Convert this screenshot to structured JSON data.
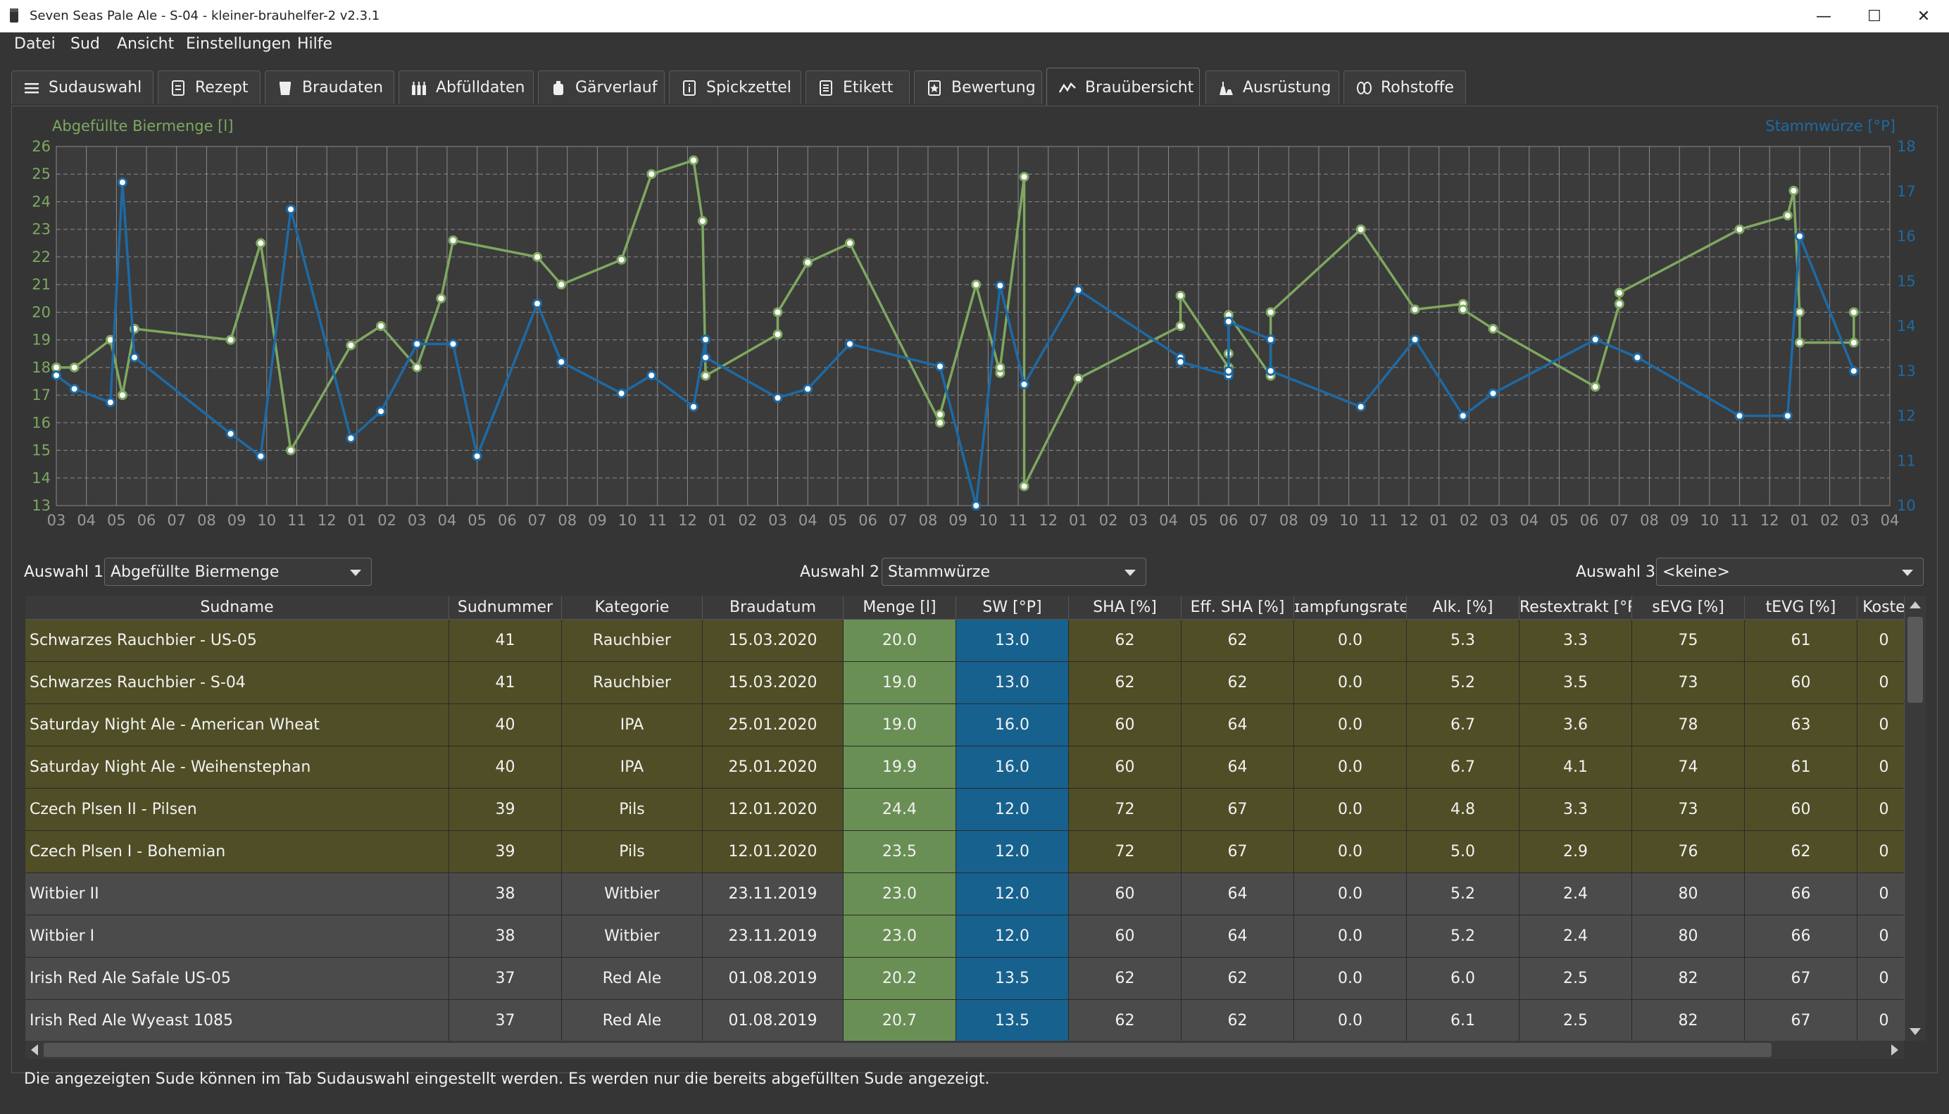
{
  "window": {
    "title": "Seven Seas Pale Ale - S-04 - kleiner-brauhelfer-2 v2.3.1",
    "minimize": "—",
    "maximize": "☐",
    "close": "✕"
  },
  "menu": [
    "Datei",
    "Sud",
    "Ansicht",
    "Einstellungen",
    "Hilfe"
  ],
  "tabs": [
    {
      "label": "Sudauswahl",
      "icon": "list-icon"
    },
    {
      "label": "Rezept",
      "icon": "recipe-icon"
    },
    {
      "label": "Braudaten",
      "icon": "kettle-icon"
    },
    {
      "label": "Abfülldaten",
      "icon": "bottles-icon"
    },
    {
      "label": "Gärverlauf",
      "icon": "fermenter-icon"
    },
    {
      "label": "Spickzettel",
      "icon": "info-note-icon"
    },
    {
      "label": "Etikett",
      "icon": "label-icon"
    },
    {
      "label": "Bewertung",
      "icon": "star-icon"
    },
    {
      "label": "Brauübersicht",
      "icon": "chart-icon",
      "active": true
    },
    {
      "label": "Ausrüstung",
      "icon": "equipment-icon"
    },
    {
      "label": "Rohstoffe",
      "icon": "hops-icon"
    }
  ],
  "chart_data": {
    "type": "line",
    "title": "",
    "ylabel_left": "Abgefüllte Biermenge [l]",
    "ylabel_right": "Stammwürze [°P]",
    "ylim_left": [
      13,
      26
    ],
    "ylim_right": [
      10,
      18
    ],
    "yticks_left": [
      "13",
      "14",
      "15",
      "16",
      "17",
      "18",
      "19",
      "20",
      "21",
      "22",
      "23",
      "24",
      "25",
      "26"
    ],
    "yticks_right": [
      "10",
      "11",
      "12",
      "13",
      "14",
      "15",
      "16",
      "17",
      "18"
    ],
    "xticks": [
      "03",
      "04",
      "05",
      "06",
      "07",
      "08",
      "09",
      "10",
      "11",
      "12",
      "01",
      "02",
      "03",
      "04",
      "05",
      "06",
      "07",
      "08",
      "09",
      "10",
      "11",
      "12",
      "01",
      "02",
      "03",
      "04",
      "05",
      "06",
      "07",
      "08",
      "09",
      "10",
      "11",
      "12",
      "01",
      "02",
      "03",
      "04",
      "05",
      "06",
      "07",
      "08",
      "09",
      "10",
      "11",
      "12",
      "01",
      "02",
      "03",
      "04",
      "05",
      "06",
      "07",
      "08",
      "09",
      "10",
      "11",
      "12",
      "01",
      "02",
      "03",
      "04"
    ],
    "grid": true,
    "series": [
      {
        "name": "Abgefüllte Biermenge",
        "axis": "left",
        "color": "#7ea860",
        "points": [
          [
            0.0,
            18.0
          ],
          [
            0.6,
            18.0
          ],
          [
            1.8,
            19.0
          ],
          [
            2.2,
            17.0
          ],
          [
            2.6,
            19.4
          ],
          [
            5.8,
            19.0
          ],
          [
            6.8,
            22.5
          ],
          [
            7.8,
            15.0
          ],
          [
            9.8,
            18.8
          ],
          [
            10.8,
            19.5
          ],
          [
            12.0,
            18.0
          ],
          [
            12.8,
            20.5
          ],
          [
            13.2,
            22.6
          ],
          [
            16.0,
            22.0
          ],
          [
            16.8,
            21.0
          ],
          [
            18.8,
            21.9
          ],
          [
            19.8,
            25.0
          ],
          [
            21.2,
            25.5
          ],
          [
            21.5,
            23.3
          ],
          [
            21.6,
            17.7
          ],
          [
            24.0,
            19.2
          ],
          [
            24.0,
            20.0
          ],
          [
            25.0,
            21.8
          ],
          [
            26.4,
            22.5
          ],
          [
            29.4,
            16.0
          ],
          [
            29.4,
            16.3
          ],
          [
            30.6,
            21.0
          ],
          [
            31.4,
            17.8
          ],
          [
            31.4,
            18.0
          ],
          [
            32.2,
            24.9
          ],
          [
            32.2,
            13.7
          ],
          [
            34.0,
            17.6
          ],
          [
            37.4,
            19.5
          ],
          [
            37.4,
            20.6
          ],
          [
            39.0,
            18.0
          ],
          [
            39.0,
            18.5
          ],
          [
            39.0,
            19.9
          ],
          [
            40.4,
            17.7
          ],
          [
            40.4,
            20.0
          ],
          [
            43.4,
            23.0
          ],
          [
            45.2,
            20.1
          ],
          [
            46.8,
            20.3
          ],
          [
            46.8,
            20.1
          ],
          [
            47.8,
            19.4
          ],
          [
            51.2,
            17.3
          ],
          [
            52.0,
            20.3
          ],
          [
            52.0,
            20.7
          ],
          [
            56.0,
            23.0
          ],
          [
            57.6,
            23.5
          ],
          [
            57.8,
            24.4
          ],
          [
            58.0,
            20.0
          ],
          [
            58.0,
            18.9
          ],
          [
            59.8,
            18.9
          ],
          [
            59.8,
            20.0
          ]
        ]
      },
      {
        "name": "Stammwürze",
        "axis": "right",
        "color": "#1d6aa5",
        "points": [
          [
            0.0,
            12.9
          ],
          [
            0.6,
            12.6
          ],
          [
            1.8,
            12.3
          ],
          [
            2.2,
            17.2
          ],
          [
            2.6,
            13.3
          ],
          [
            5.8,
            11.6
          ],
          [
            6.8,
            11.1
          ],
          [
            7.8,
            16.6
          ],
          [
            9.8,
            11.5
          ],
          [
            10.8,
            12.1
          ],
          [
            12.0,
            13.6
          ],
          [
            13.2,
            13.6
          ],
          [
            14.0,
            11.1
          ],
          [
            16.0,
            14.5
          ],
          [
            16.8,
            13.2
          ],
          [
            18.8,
            12.5
          ],
          [
            19.8,
            12.9
          ],
          [
            21.2,
            12.2
          ],
          [
            21.6,
            13.7
          ],
          [
            21.6,
            13.3
          ],
          [
            24.0,
            12.4
          ],
          [
            25.0,
            12.6
          ],
          [
            26.4,
            13.6
          ],
          [
            29.4,
            13.1
          ],
          [
            30.6,
            10.0
          ],
          [
            31.4,
            14.9
          ],
          [
            32.2,
            12.7
          ],
          [
            34.0,
            14.8
          ],
          [
            37.4,
            13.3
          ],
          [
            37.4,
            13.2
          ],
          [
            39.0,
            12.9
          ],
          [
            39.0,
            13.0
          ],
          [
            39.0,
            14.1
          ],
          [
            40.4,
            13.7
          ],
          [
            40.4,
            13.0
          ],
          [
            43.4,
            12.2
          ],
          [
            45.2,
            13.7
          ],
          [
            46.8,
            12.0
          ],
          [
            47.8,
            12.5
          ],
          [
            51.2,
            13.7
          ],
          [
            52.6,
            13.3
          ],
          [
            56.0,
            12.0
          ],
          [
            57.6,
            12.0
          ],
          [
            58.0,
            16.0
          ],
          [
            59.8,
            13.0
          ]
        ]
      }
    ]
  },
  "selectors": {
    "auswahl1_label": "Auswahl 1",
    "auswahl1_value": "Abgefüllte Biermenge",
    "auswahl2_label": "Auswahl 2",
    "auswahl2_value": "Stammwürze",
    "auswahl3_label": "Auswahl 3",
    "auswahl3_value": "<keine>"
  },
  "table": {
    "columns": [
      "Sudname",
      "Sudnummer",
      "Kategorie",
      "Braudatum",
      "Menge [l]",
      "SW [°P]",
      "SHA [%]",
      "Eff. SHA [%]",
      "ɪampfungsrate [",
      "Alk. [%]",
      "Restextrakt [°P]",
      "sEVG [%]",
      "tEVG [%]",
      "Koste"
    ],
    "rows": [
      {
        "cells": [
          "Schwarzes Rauchbier - US-05",
          "41",
          "Rauchbier",
          "15.03.2020",
          "20.0",
          "13.0",
          "62",
          "62",
          "0.0",
          "5.3",
          "3.3",
          "75",
          "61",
          "0"
        ],
        "style": "olive"
      },
      {
        "cells": [
          "Schwarzes Rauchbier - S-04",
          "41",
          "Rauchbier",
          "15.03.2020",
          "19.0",
          "13.0",
          "62",
          "62",
          "0.0",
          "5.2",
          "3.5",
          "73",
          "60",
          "0"
        ],
        "style": "olive"
      },
      {
        "cells": [
          "Saturday Night Ale - American Wheat",
          "40",
          "IPA",
          "25.01.2020",
          "19.0",
          "16.0",
          "60",
          "64",
          "0.0",
          "6.7",
          "3.6",
          "78",
          "63",
          "0"
        ],
        "style": "olive"
      },
      {
        "cells": [
          "Saturday Night Ale - Weihenstephan",
          "40",
          "IPA",
          "25.01.2020",
          "19.9",
          "16.0",
          "60",
          "64",
          "0.0",
          "6.7",
          "4.1",
          "74",
          "61",
          "0"
        ],
        "style": "olive"
      },
      {
        "cells": [
          "Czech Plsen  II - Pilsen",
          "39",
          "Pils",
          "12.01.2020",
          "24.4",
          "12.0",
          "72",
          "67",
          "0.0",
          "4.8",
          "3.3",
          "73",
          "60",
          "0"
        ],
        "style": "olive"
      },
      {
        "cells": [
          "Czech Plsen I - Bohemian",
          "39",
          "Pils",
          "12.01.2020",
          "23.5",
          "12.0",
          "72",
          "67",
          "0.0",
          "5.0",
          "2.9",
          "76",
          "62",
          "0"
        ],
        "style": "olive"
      },
      {
        "cells": [
          "Witbier II",
          "38",
          "Witbier",
          "23.11.2019",
          "23.0",
          "12.0",
          "60",
          "64",
          "0.0",
          "5.2",
          "2.4",
          "80",
          "66",
          "0"
        ],
        "style": "gray"
      },
      {
        "cells": [
          "Witbier I",
          "38",
          "Witbier",
          "23.11.2019",
          "23.0",
          "12.0",
          "60",
          "64",
          "0.0",
          "5.2",
          "2.4",
          "80",
          "66",
          "0"
        ],
        "style": "gray"
      },
      {
        "cells": [
          "Irish Red Ale Safale US-05",
          "37",
          "Red Ale",
          "01.08.2019",
          "20.2",
          "13.5",
          "62",
          "62",
          "0.0",
          "6.0",
          "2.5",
          "82",
          "67",
          "0"
        ],
        "style": "gray"
      },
      {
        "cells": [
          "Irish Red Ale Wyeast 1085",
          "37",
          "Red Ale",
          "01.08.2019",
          "20.7",
          "13.5",
          "62",
          "62",
          "0.0",
          "6.1",
          "2.5",
          "82",
          "67",
          "0"
        ],
        "style": "gray"
      }
    ],
    "colors": {
      "olive": "#4f4e26",
      "gray": "#4b4b4b",
      "menge": "#6a8f55",
      "sw": "#17618f"
    }
  },
  "status": "Die angezeigten Sude können im Tab Sudauswahl eingestellt werden. Es werden nur die bereits abgefüllten Sude angezeigt."
}
